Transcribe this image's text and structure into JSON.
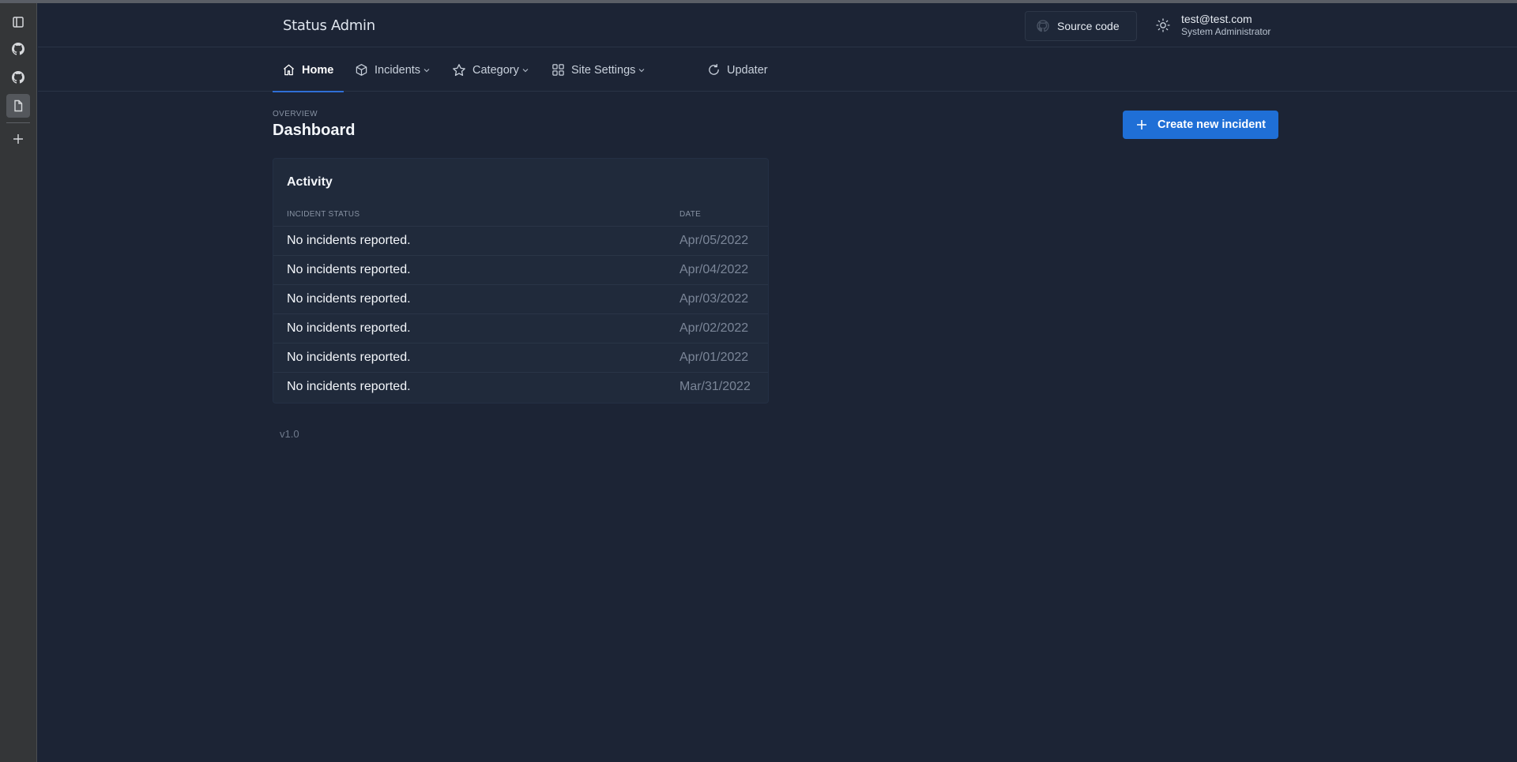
{
  "app_title": "Status Admin",
  "header": {
    "source_code_label": "Source code",
    "user_email": "test@test.com",
    "user_role": "System Administrator"
  },
  "nav": {
    "items": [
      {
        "label": "Home",
        "icon": "home-icon",
        "active": true
      },
      {
        "label": "Incidents",
        "icon": "box-icon",
        "dropdown": true
      },
      {
        "label": "Category",
        "icon": "star-icon",
        "dropdown": true
      },
      {
        "label": "Site Settings",
        "icon": "grid-icon",
        "dropdown": true
      },
      {
        "label": "Updater",
        "icon": "refresh-icon"
      }
    ]
  },
  "page": {
    "overline": "OVERVIEW",
    "title": "Dashboard",
    "create_button_label": "Create new incident"
  },
  "activity": {
    "title": "Activity",
    "columns": [
      "INCIDENT STATUS",
      "DATE"
    ],
    "rows": [
      {
        "status": "No incidents reported.",
        "date": "Apr/05/2022"
      },
      {
        "status": "No incidents reported.",
        "date": "Apr/04/2022"
      },
      {
        "status": "No incidents reported.",
        "date": "Apr/03/2022"
      },
      {
        "status": "No incidents reported.",
        "date": "Apr/02/2022"
      },
      {
        "status": "No incidents reported.",
        "date": "Apr/01/2022"
      },
      {
        "status": "No incidents reported.",
        "date": "Mar/31/2022"
      }
    ]
  },
  "footer": {
    "version": "v1.0"
  },
  "colors": {
    "background": "#1c2435",
    "card": "#202a3b",
    "accent": "#1f6fd6",
    "rail": "#343638"
  }
}
